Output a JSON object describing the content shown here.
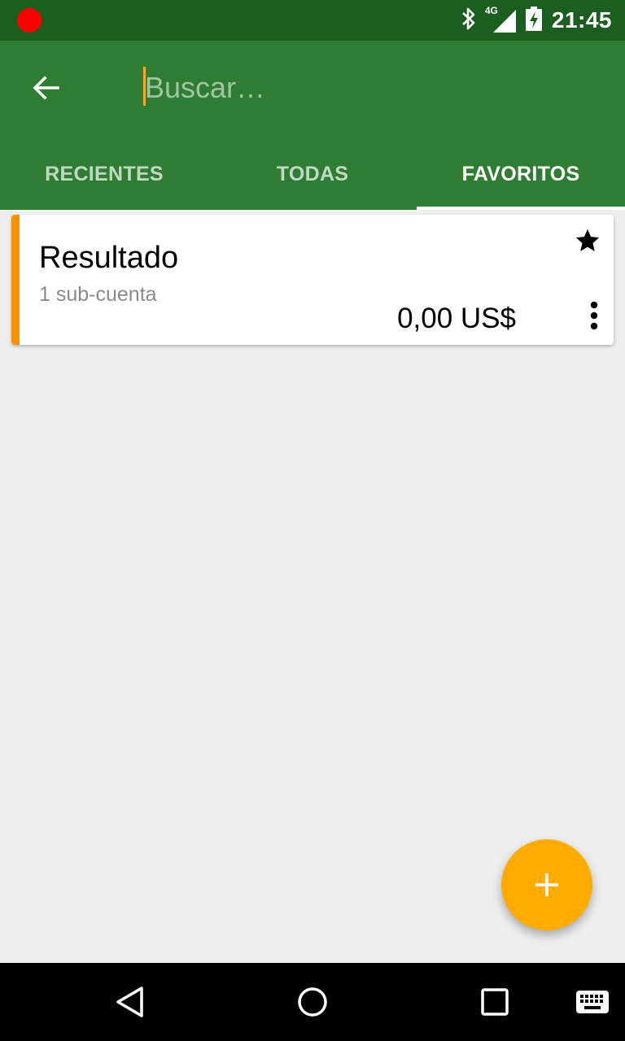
{
  "status_bar": {
    "time": "21:45",
    "network_label": "4G",
    "icons": [
      "record-dot-icon",
      "bluetooth-icon",
      "signal-icon",
      "battery-charging-icon"
    ]
  },
  "search": {
    "placeholder": "Buscar…",
    "value": ""
  },
  "tabs": [
    {
      "label": "RECIENTES",
      "active": false
    },
    {
      "label": "TODAS",
      "active": false
    },
    {
      "label": "FAVORITOS",
      "active": true
    }
  ],
  "accounts": [
    {
      "name": "Resultado",
      "subtitle": "1 sub-cuenta",
      "balance": "0,00 US$",
      "favorite": true,
      "accent_color": "#f59300"
    }
  ],
  "colors": {
    "status_bar": "#1b5e20",
    "primary": "#2e7d32",
    "fab": "#ffab00",
    "background": "#eeeeee"
  },
  "icons": {
    "back": "arrow-back-icon",
    "favorite": "star-icon",
    "overflow": "more-vert-icon",
    "fab": "add-icon",
    "nav_back": "nav-back-icon",
    "nav_home": "nav-home-icon",
    "nav_recents": "nav-recents-icon",
    "keyboard": "keyboard-icon"
  }
}
